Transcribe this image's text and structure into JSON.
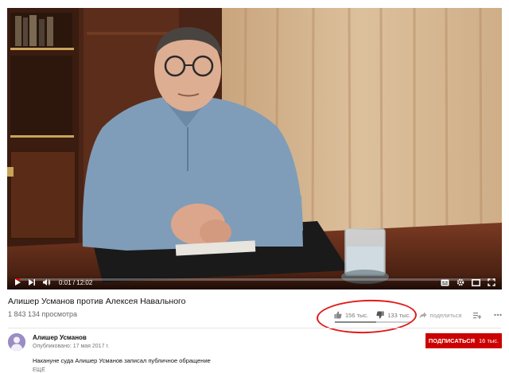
{
  "player": {
    "time_current": "0:01",
    "time_total": "12:02",
    "progress": 0.001
  },
  "video": {
    "title": "Алишер Усманов против Алексея Навального",
    "views": "1 843 134 просмотра",
    "likes": "156 тыс.",
    "dislikes": "133 тыс.",
    "share_label": "поделиться",
    "like_ratio": 0.54
  },
  "channel": {
    "name": "Алишер Усманов",
    "published": "Опубликовано: 17 мая 2017 г.",
    "subscribe_label": "ПОДПИСАТЬСЯ",
    "subscriber_count": "16 тыс."
  },
  "description": {
    "text": "Накануне суда Алишер Усманов записал публичное обращение",
    "more_label": "ЕЩЁ"
  },
  "colors": {
    "accent_red": "#cc0000",
    "annotation_red": "#e21a1a",
    "progress_red": "#ff0000"
  },
  "icons": [
    "play-icon",
    "next-icon",
    "volume-icon",
    "subtitles-icon",
    "settings-icon",
    "miniplayer-icon",
    "fullscreen-icon",
    "like-icon",
    "dislike-icon",
    "share-icon",
    "add-to-playlist-icon",
    "more-icon"
  ]
}
